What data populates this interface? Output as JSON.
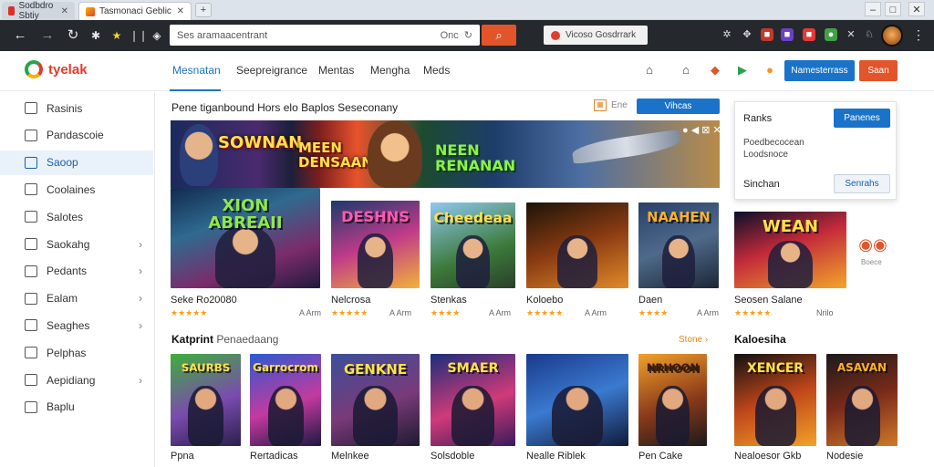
{
  "browser": {
    "tab_inactive_title": "Sodbdro Sbtiy",
    "tab_active_title": "Tasmonaci Geblic",
    "tab_new_label": "+",
    "win_min": "–",
    "win_max": "□",
    "win_close": "✕",
    "address_text": "Ses aramaacentrant",
    "address_suffix": "Onc",
    "bookmark_label": "Vicoso Gosdrrark"
  },
  "header": {
    "brand": "tyelak",
    "nav": [
      "Mesnatan",
      "Seepreigrance",
      "Mentas",
      "Mengha",
      "Meds"
    ],
    "btn_primary": "Namesterrass",
    "btn_secondary": "Saan"
  },
  "sidebar": {
    "items": [
      {
        "label": "Rasinis",
        "chevron": false
      },
      {
        "label": "Pandascoie",
        "chevron": false
      },
      {
        "label": "Saoop",
        "chevron": false,
        "active": true
      },
      {
        "label": "Coolaines",
        "chevron": false
      },
      {
        "label": "Salotes",
        "chevron": false
      },
      {
        "label": "Saokahg",
        "chevron": true
      },
      {
        "label": "Pedants",
        "chevron": true
      },
      {
        "label": "Ealam",
        "chevron": true
      },
      {
        "label": "Seaghes",
        "chevron": true
      },
      {
        "label": "Pelphas",
        "chevron": false
      },
      {
        "label": "Aepidiang",
        "chevron": true
      },
      {
        "label": "Baplu",
        "chevron": false
      }
    ]
  },
  "featured": {
    "title": "Pene tiganbound Hors elo Baplos Seseconany",
    "muted": "Ene",
    "button": "Vihcas",
    "banner_texts": [
      "SOWNAN",
      "MEEN\nDENSAAN",
      "NEEN\nRENANAN"
    ],
    "banner_icons": "● ◀ ⊠ ✕"
  },
  "popup": {
    "title": "Ranks",
    "button": "Panenes",
    "desc1": "Poedbecocean",
    "desc2": "Loodsnoce",
    "label": "Sinchan",
    "button2": "Senrahs"
  },
  "row1": [
    {
      "title": "Seke Ro20080",
      "stars": "★★★★★",
      "meta": "A Arm",
      "art": "XION\nABREAII"
    },
    {
      "title": "Nelcrosa",
      "stars": "★★★★★",
      "meta": "A Arm",
      "art": "DESHNS"
    },
    {
      "title": "Stenkas",
      "stars": "★★★★",
      "meta": "A Arm",
      "art": "Cheedeaa"
    },
    {
      "title": "Koloebo",
      "stars": "★★★★★",
      "meta": "A Arm",
      "art": ""
    },
    {
      "title": "Daen",
      "stars": "★★★★",
      "meta": "A Arm",
      "art": "NAAHEN"
    },
    {
      "title": "Seosen Salane",
      "stars": "★★★★★",
      "meta": "Nrilo",
      "art": "WEAN"
    }
  ],
  "row1_side_label": "Boece",
  "row2_header": {
    "title": "Katprint",
    "subtitle": "Penaedaang",
    "see_all": "Stone"
  },
  "row2_side_title": "Kaloesiha",
  "row2": [
    {
      "title": "Ppna",
      "art": "SAURBS"
    },
    {
      "title": "Rertadicas",
      "art": "Garrocrom"
    },
    {
      "title": "Melnkee",
      "art": "GENKNE"
    },
    {
      "title": "Solsdoble",
      "art": "SMAER"
    },
    {
      "title": "Nealle Riblek",
      "art": ""
    },
    {
      "title": "Pen Cake",
      "art": "NRHOON"
    },
    {
      "title": "Nealoesor Gkb",
      "art": "XENCER"
    },
    {
      "title": "Nodesie",
      "art": "ASAVAN"
    }
  ],
  "colors": {
    "accent": "#1a73c8",
    "brand_orange": "#e2552a",
    "toolbar_bg": "#25282d",
    "star": "#f2a11f"
  }
}
